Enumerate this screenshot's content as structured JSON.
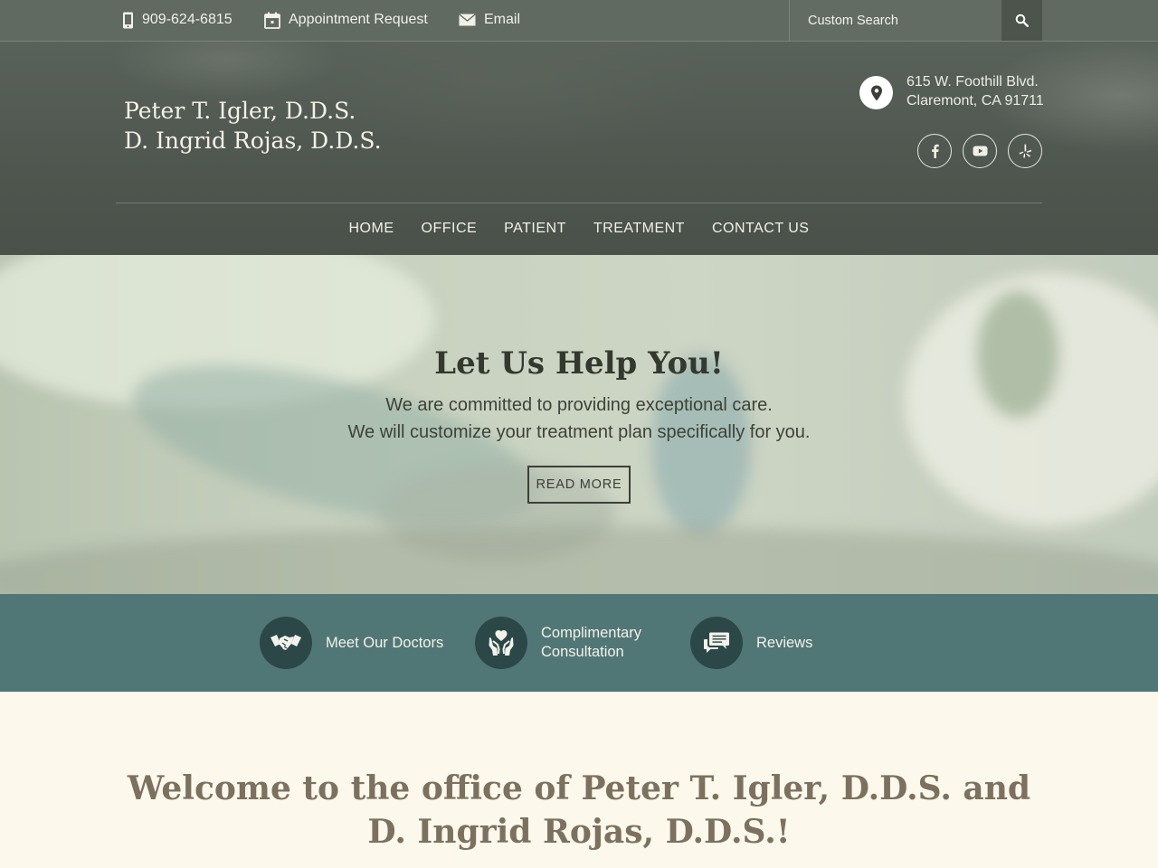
{
  "topbar": {
    "phone": "909-624-6815",
    "appointment": "Appointment Request",
    "email": "Email",
    "search_placeholder": "Custom Search",
    "icons": {
      "phone": "mobile-phone-icon",
      "appointment": "calendar-icon",
      "email": "envelope-icon",
      "search": "magnifier-icon"
    }
  },
  "header": {
    "brand_line1": "Peter T. Igler, D.D.S.",
    "brand_line2": "D. Ingrid Rojas, D.D.S.",
    "address_line1": "615 W. Foothill Blvd.",
    "address_line2": "Claremont, CA 91711",
    "social": [
      "facebook-icon",
      "youtube-icon",
      "yelp-icon"
    ]
  },
  "nav": {
    "items": [
      "HOME",
      "OFFICE",
      "PATIENT",
      "TREATMENT",
      "CONTACT US"
    ]
  },
  "hero": {
    "title": "Let Us Help You!",
    "line1": "We are committed to providing exceptional care.",
    "line2": "We will customize your treatment plan specifically for you.",
    "button": "READ MORE"
  },
  "features": [
    {
      "label": "Meet Our Doctors",
      "icon": "handshake-icon"
    },
    {
      "label_line1": "Complimentary",
      "label_line2": "Consultation",
      "icon": "hands-heart-icon"
    },
    {
      "label": "Reviews",
      "icon": "chat-bubble-icon"
    }
  ],
  "welcome": {
    "heading": "Welcome to the office of Peter T. Igler, D.D.S. and D. Ingrid Rojas, D.D.S.!"
  },
  "colors": {
    "topbar": "#606a60",
    "header": "#4e564f",
    "features_band": "#517676",
    "feature_circle": "#2c4747",
    "page_background": "#fdf8ec",
    "welcome_text": "#7c715f"
  }
}
